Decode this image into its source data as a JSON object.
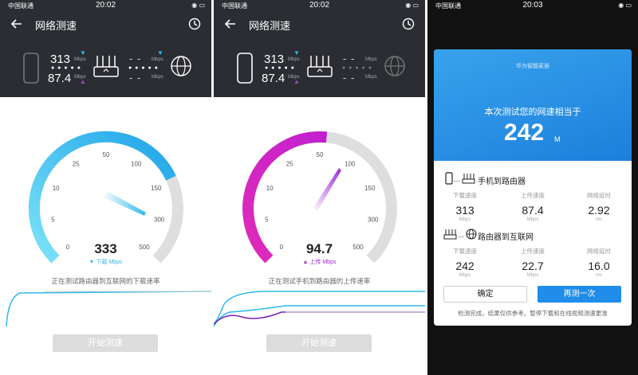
{
  "screens": [
    {
      "status": {
        "carrier": "中国联通",
        "time": "20:02"
      },
      "header": {
        "title": "网络测速"
      },
      "stats": {
        "download": "313",
        "upload": "87.4",
        "unit": "Mbps",
        "router_download": "- -",
        "router_upload": "- -"
      },
      "gauge": {
        "ticks": [
          "0",
          "5",
          "10",
          "25",
          "50",
          "100",
          "150",
          "300",
          "500"
        ],
        "value": "333",
        "unit_label": "▼ 下载 Mbps",
        "progress": 0.74,
        "label": "正在测试路由器到互联网的下载速率"
      },
      "start_button": "开始测速"
    },
    {
      "status": {
        "carrier": "中国联通",
        "time": "20:02"
      },
      "header": {
        "title": "网络测速"
      },
      "stats": {
        "download": "313",
        "upload": "87.4",
        "unit": "Mbps",
        "router_download": "- -",
        "router_upload": "- -"
      },
      "gauge": {
        "ticks": [
          "0",
          "5",
          "10",
          "25",
          "50",
          "100",
          "150",
          "300",
          "500"
        ],
        "value": "94.7",
        "unit_label": "▲ 上传 Mbps",
        "progress": 0.52,
        "label": "正在测试手机到路由器的上传速率"
      },
      "start_button": "开始测速"
    }
  ],
  "result_screen": {
    "status": {
      "carrier": "中国联通",
      "time": "20:03"
    },
    "brand": "华为智能家居",
    "equivalent_text": "本次测试您的网速相当于",
    "result_value": "242",
    "result_unit": "M",
    "section1": {
      "title": "手机到路由器",
      "columns": [
        {
          "label": "下载速度",
          "value": "313",
          "unit": "Mbps"
        },
        {
          "label": "上传速度",
          "value": "87.4",
          "unit": "Mbps"
        },
        {
          "label": "网络延时",
          "value": "2.92",
          "unit": "ms"
        }
      ]
    },
    "section2": {
      "title": "路由器到互联网",
      "columns": [
        {
          "label": "下载速度",
          "value": "242",
          "unit": "Mbps"
        },
        {
          "label": "上传速度",
          "value": "22.7",
          "unit": "Mbps"
        },
        {
          "label": "网络延时",
          "value": "16.0",
          "unit": "ms"
        }
      ]
    },
    "ok_button": "确定",
    "again_button": "再测一次",
    "note": "检测完成，结果仅供参考。暂停下载和在线视频测速更准"
  },
  "colors": {
    "header_bg": "#2b2d33",
    "gauge1": "#2fb9ec",
    "gauge2": "#d41cbd",
    "track": "#dedede",
    "accent_blue": "#1f8de9",
    "purple": "#7a1fb5"
  }
}
